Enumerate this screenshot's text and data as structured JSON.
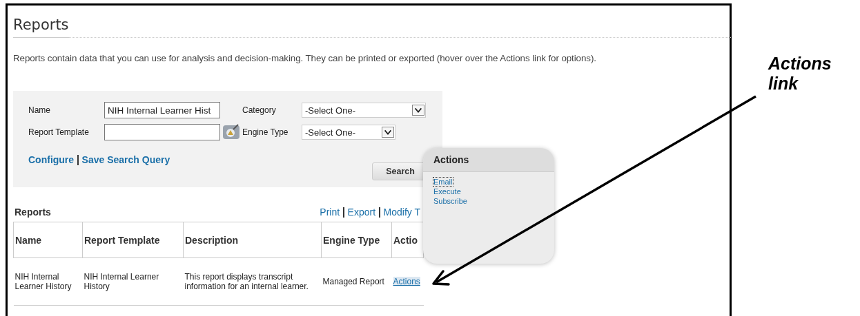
{
  "page": {
    "title": "Reports",
    "intro": "Reports contain data that you can use for analysis and decision-making. They can be printed or exported (hover over the Actions link for options)."
  },
  "search_panel": {
    "fields": [
      {
        "label": "Name",
        "kind": "text",
        "value": "NIH Internal Learner Hist"
      },
      {
        "label": "Category",
        "kind": "select",
        "value": "-Select One-"
      },
      {
        "label": "Report Template",
        "kind": "picker"
      },
      {
        "label": "Engine Type",
        "kind": "select",
        "value": "-Select One-"
      }
    ],
    "links": [
      "Configure",
      "Save Search Query"
    ],
    "search_button": "Search"
  },
  "reports": {
    "title": "Reports",
    "links": [
      "Print",
      "Export",
      "Modify T"
    ],
    "columns": [
      "Name",
      "Report Template",
      "Description",
      "Engine Type",
      "Actio"
    ],
    "rows": [
      {
        "cells": [
          "NIH Internal Learner History",
          "NIH Internal Learner History",
          "This report displays transcript information for an internal learner.",
          "Managed Report"
        ],
        "action": "Actions"
      }
    ]
  },
  "actions_popup": {
    "title": "Actions",
    "items": [
      {
        "label": "Email",
        "focused": true
      },
      {
        "label": "Execute",
        "focused": false
      },
      {
        "label": "Subscribe",
        "focused": false
      }
    ]
  },
  "annotation": {
    "text": "Actions link"
  }
}
